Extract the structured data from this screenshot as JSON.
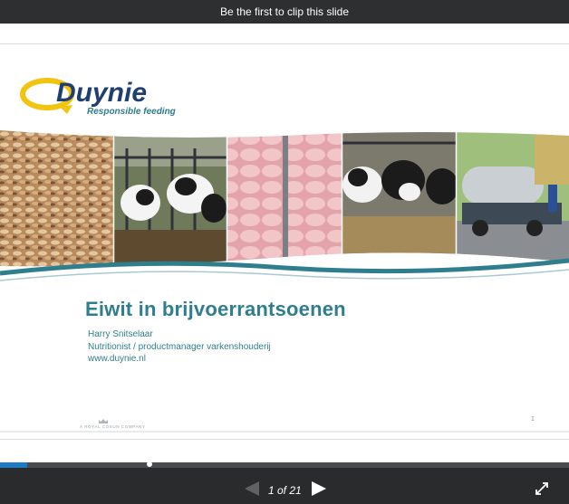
{
  "topbar": {
    "clip_text": "Be the first to clip this slide"
  },
  "slide": {
    "logo": {
      "brand": "Duynie",
      "tagline": "Responsible feeding"
    },
    "title": "Eiwit in brijvoerrantsoenen",
    "author": "Harry Snitselaar",
    "role": "Nutritionist / productmanager varkenshouderij",
    "website": "www.duynie.nl",
    "footer_text": "A ROYAL COSUN COMPANY",
    "page_number": "1"
  },
  "player": {
    "progress_fraction": 0.048,
    "counter": {
      "current": 1,
      "total": 21,
      "text": "1 of 21"
    }
  },
  "colors": {
    "teal": "#2f7e8e",
    "logo_navy": "#1f3f70",
    "logo_yellow": "#f2c30f",
    "progress": "#1c7bc4",
    "bar_bg": "#2a2b2d"
  },
  "icons": {
    "prev": "triangle-left-icon",
    "next": "triangle-right-icon",
    "fullscreen": "expand-arrows-icon"
  }
}
